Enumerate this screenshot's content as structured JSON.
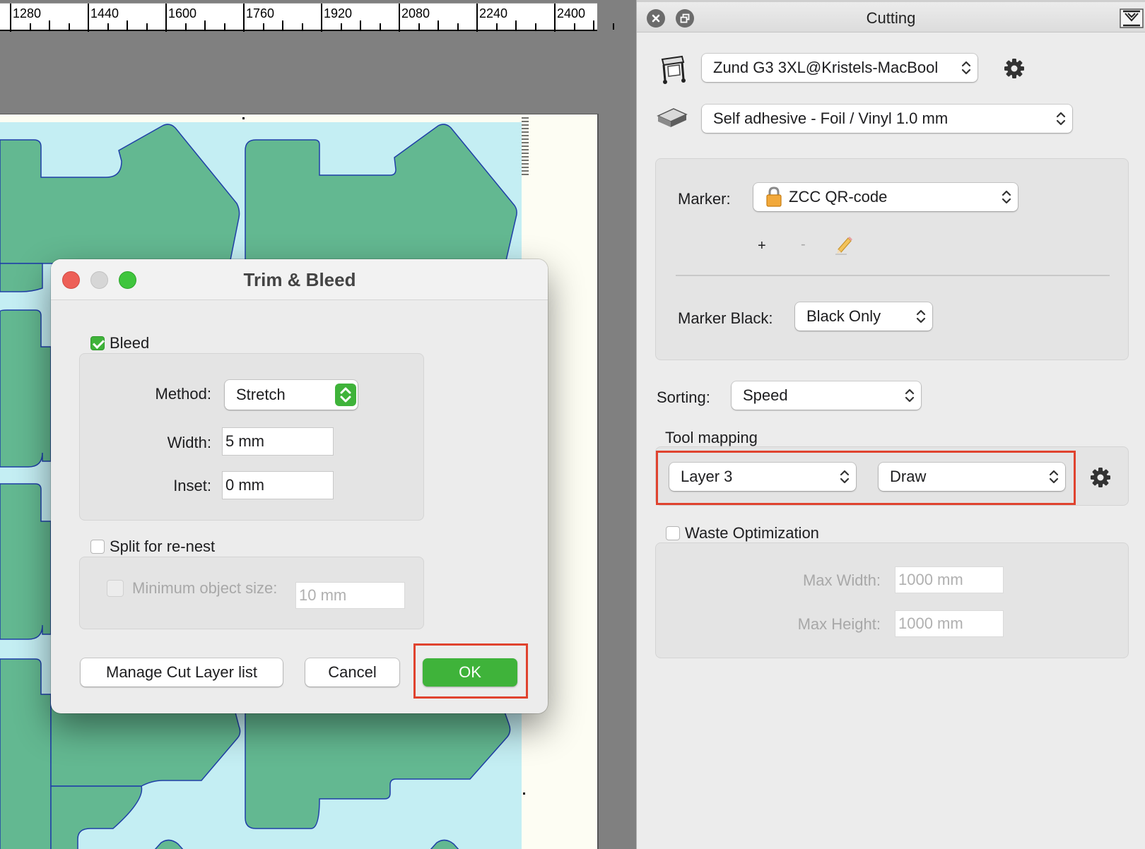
{
  "ruler": {
    "labels": [
      "1280",
      "1440",
      "1600",
      "1760",
      "1920",
      "2080",
      "2240",
      "2400"
    ]
  },
  "dialog": {
    "title": "Trim & Bleed",
    "bleed": {
      "label": "Bleed",
      "checked": true,
      "method_label": "Method:",
      "method_value": "Stretch",
      "width_label": "Width:",
      "width_value": "5 mm",
      "inset_label": "Inset:",
      "inset_value": "0 mm"
    },
    "split": {
      "label": "Split for re-nest",
      "checked": false,
      "min_size_label": "Minimum object size:",
      "min_size_value": "10 mm"
    },
    "buttons": {
      "manage": "Manage Cut Layer list",
      "cancel": "Cancel",
      "ok": "OK"
    }
  },
  "panel": {
    "title": "Cutting",
    "device": "Zund G3 3XL@Kristels-MacBool",
    "material": "Self adhesive - Foil / Vinyl 1.0 mm",
    "marker_label": "Marker:",
    "marker_value": "ZCC QR-code",
    "add_symbol": "+",
    "remove_symbol": "-",
    "marker_black_label": "Marker Black:",
    "marker_black_value": "Black Only",
    "sorting_label": "Sorting:",
    "sorting_value": "Speed",
    "tool_mapping_label": "Tool mapping",
    "tool_mapping_layer": "Layer 3",
    "tool_mapping_tool": "Draw",
    "waste_label": "Waste Optimization",
    "waste_checked": false,
    "max_width_label": "Max Width:",
    "max_width_value": "1000 mm",
    "max_height_label": "Max Height:",
    "max_height_value": "1000 mm"
  },
  "colors": {
    "accent_green": "#3fb33a",
    "highlight_red": "#e0432f",
    "artwork_background": "#c4eef3",
    "shape_fill": "#63b891",
    "shape_stroke": "#1f3fa8"
  }
}
